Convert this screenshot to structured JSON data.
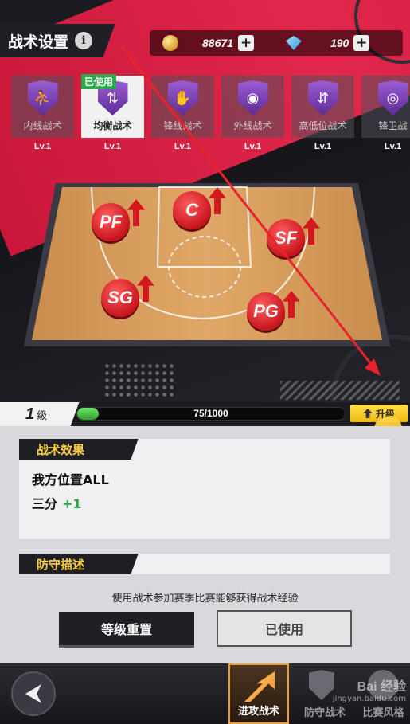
{
  "header": {
    "title": "战术设置",
    "info_icon": "info-icon",
    "info_glyph": "i"
  },
  "currency": {
    "coins": "88671",
    "gems": "190",
    "plus_glyph": "+"
  },
  "tactics": [
    {
      "name": "内线战术",
      "level": "Lv.1",
      "selected": false,
      "used": false,
      "glyph": "⛹"
    },
    {
      "name": "均衡战术",
      "level": "Lv.1",
      "selected": true,
      "used": true,
      "used_label": "已使用",
      "glyph": "⇅"
    },
    {
      "name": "锋线战术",
      "level": "Lv.1",
      "selected": false,
      "used": false,
      "glyph": "✋"
    },
    {
      "name": "外线战术",
      "level": "Lv.1",
      "selected": false,
      "used": false,
      "glyph": "◉"
    },
    {
      "name": "高低位战术",
      "level": "Lv.1",
      "selected": false,
      "used": false,
      "glyph": "⇵"
    },
    {
      "name": "锋卫战",
      "level": "Lv.1",
      "selected": false,
      "used": false,
      "glyph": "◎"
    }
  ],
  "court": {
    "positions": [
      {
        "label": "PF"
      },
      {
        "label": "C"
      },
      {
        "label": "SF"
      },
      {
        "label": "SG"
      },
      {
        "label": "PG"
      }
    ]
  },
  "level": {
    "number": "1",
    "unit": "级",
    "xp_text": "75/1000",
    "xp_current": 75,
    "xp_max": 1000,
    "upgrade_label": "升级"
  },
  "effect": {
    "header": "战术效果",
    "line1": "我方位置ALL",
    "line2_label": "三分",
    "line2_bonus": "+1"
  },
  "defense": {
    "header": "防守描述"
  },
  "hint": "使用战术参加赛季比赛能够获得战术经验",
  "buttons": {
    "reset": "等级重置",
    "used": "已使用"
  },
  "nav": {
    "offense": "进攻战术",
    "defense": "防守战术",
    "style": "比赛风格"
  },
  "watermark": {
    "logo": "Bai 经验",
    "url": "jingyan.baidu.com"
  },
  "colors": {
    "accent_red": "#d21f43",
    "gold": "#ffd23a",
    "green": "#2aa84a"
  }
}
